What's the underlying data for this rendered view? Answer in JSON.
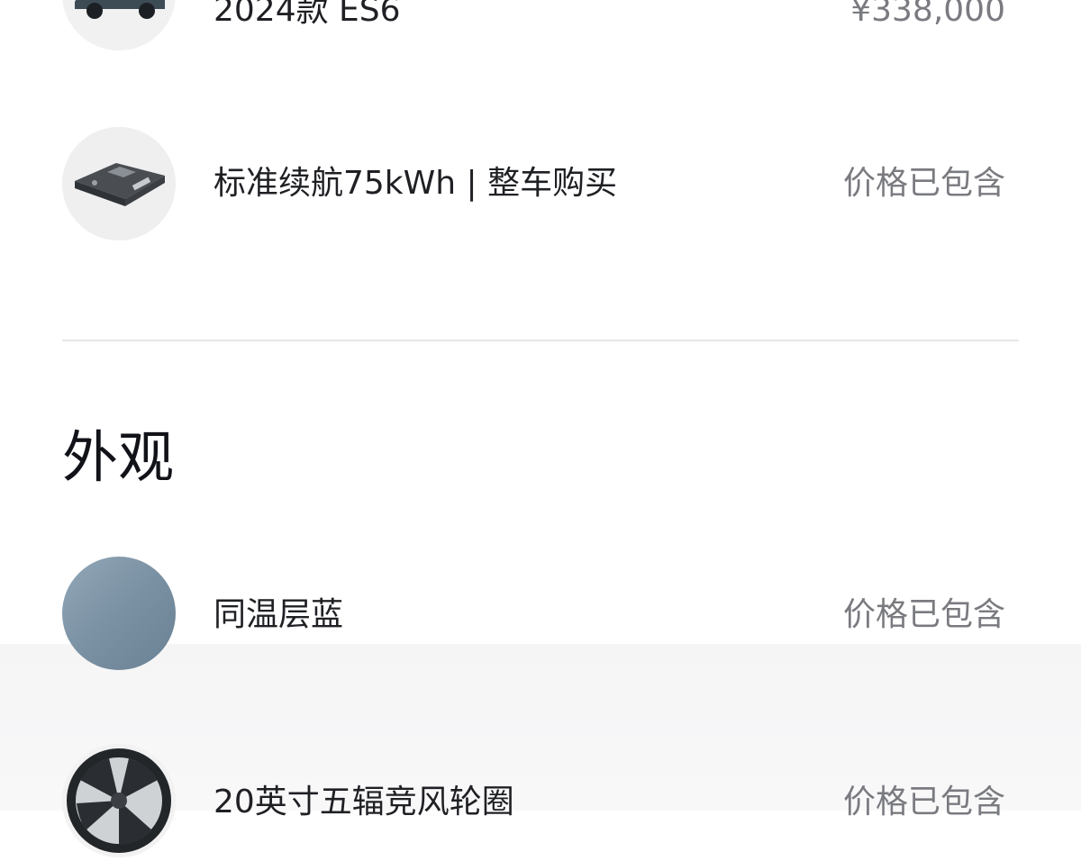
{
  "powertrain": {
    "items": [
      {
        "name": "2024款 ES6",
        "price": "¥338,000",
        "thumb": "car-thumbnail"
      },
      {
        "name": "标准续航75kWh | 整车购买",
        "price": "价格已包含",
        "thumb": "battery-pack-thumbnail"
      }
    ]
  },
  "exterior": {
    "title": "外观",
    "items": [
      {
        "name": "同温层蓝",
        "price": "价格已包含",
        "thumb": "color-swatch",
        "color": "#7f96a8"
      },
      {
        "name": "20英寸五辐竞风轮圈",
        "price": "价格已包含",
        "thumb": "wheel-rim-thumbnail"
      }
    ]
  }
}
